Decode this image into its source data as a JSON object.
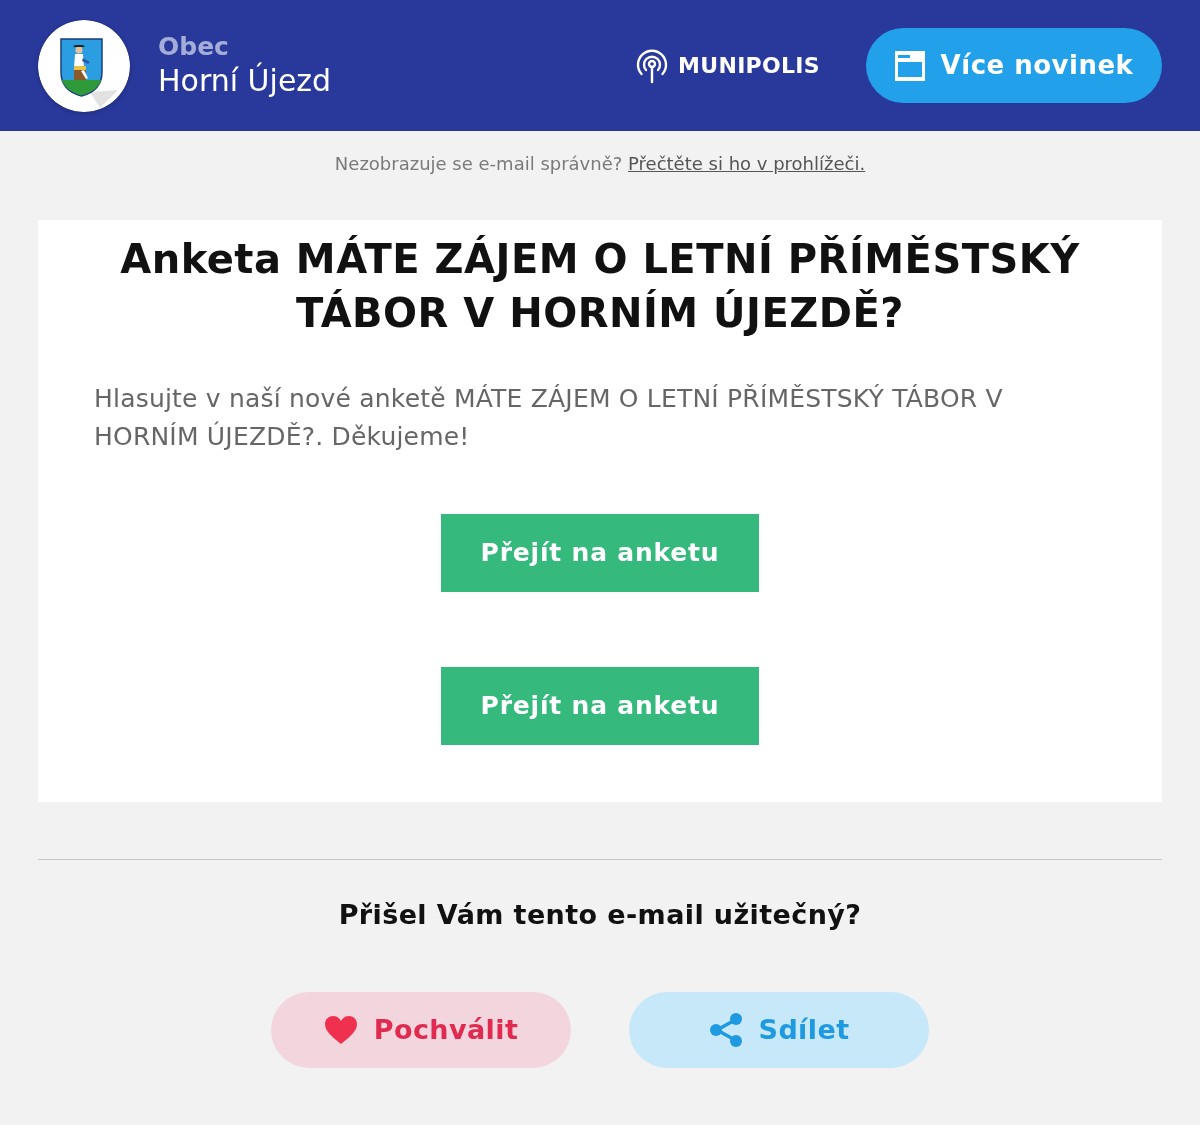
{
  "header": {
    "municipality_label": "Obec",
    "municipality_name": "Horní Újezd",
    "brand": "MUNIPOLIS",
    "more_news_button": "Více novinek"
  },
  "notice": {
    "text": "Nezobrazuje se e-mail správně?",
    "link": "Přečtěte si ho v prohlížeči."
  },
  "article": {
    "title": "Anketa MÁTE ZÁJEM O LETNÍ PŘÍMĚSTSKÝ TÁBOR V HORNÍM ÚJEZDĚ?",
    "body": "Hlasujte v naší nové anketě MÁTE ZÁJEM O LETNÍ PŘÍMĚSTSKÝ TÁBOR V HORNÍM ÚJEZDĚ?. Děkujeme!",
    "buttons": [
      "Přejít na anketu",
      "Přejít na anketu"
    ]
  },
  "feedback": {
    "question": "Přišel Vám tento e-mail užitečný?",
    "actions": [
      {
        "kind": "praise",
        "label": "Pochválit"
      },
      {
        "kind": "share",
        "label": "Sdílet"
      }
    ]
  }
}
